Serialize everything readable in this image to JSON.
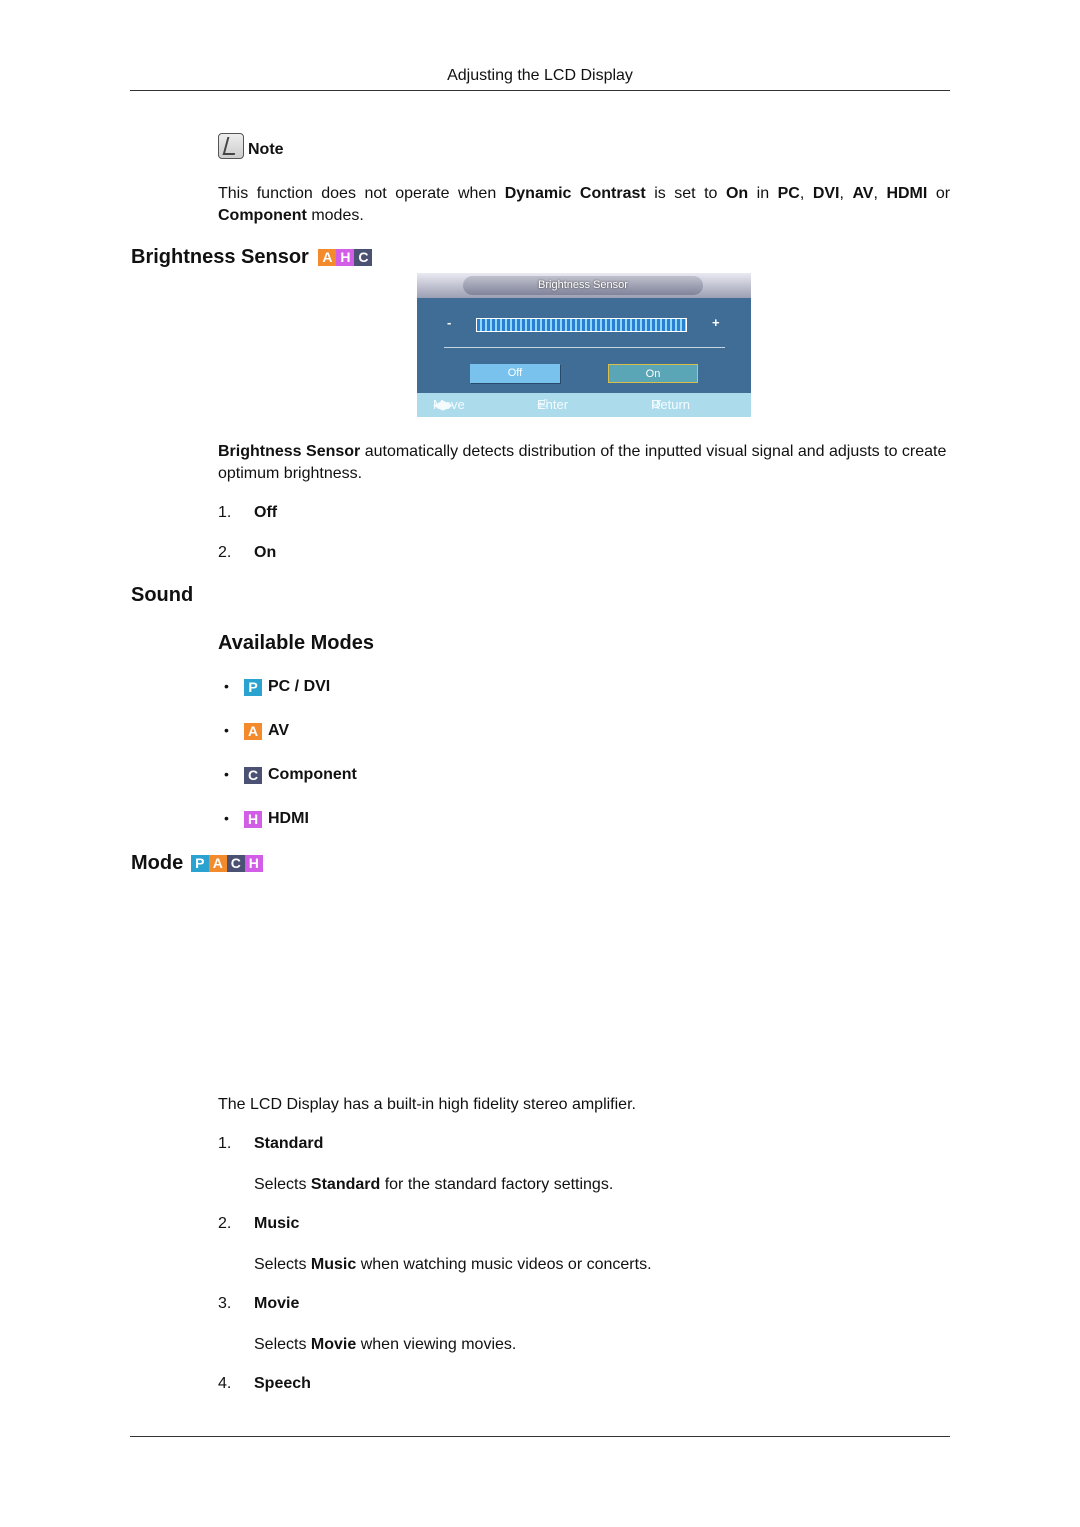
{
  "header": {
    "title": "Adjusting the LCD Display"
  },
  "note": {
    "label": "Note",
    "icon": "note-pencil-icon",
    "text_parts": [
      {
        "t": "This function does not operate when ",
        "b": false
      },
      {
        "t": "Dynamic Contrast",
        "b": true
      },
      {
        "t": " is set to ",
        "b": false
      },
      {
        "t": "On",
        "b": true
      },
      {
        "t": " in ",
        "b": false
      },
      {
        "t": "PC",
        "b": true
      },
      {
        "t": ", ",
        "b": false
      },
      {
        "t": "DVI",
        "b": true
      },
      {
        "t": ", ",
        "b": false
      },
      {
        "t": "AV",
        "b": true
      },
      {
        "t": ", ",
        "b": false
      },
      {
        "t": "HDMI",
        "b": true
      },
      {
        "t": " or ",
        "b": false
      },
      {
        "t": "Component",
        "b": true
      },
      {
        "t": " modes.",
        "b": false
      }
    ]
  },
  "brightness_sensor": {
    "heading": "Brightness Sensor",
    "badges": [
      "A",
      "H",
      "C"
    ],
    "osd": {
      "title": "Brightness Sensor",
      "minus": "-",
      "plus": "+",
      "options": [
        "Off",
        "On"
      ],
      "selected": "On",
      "footer": {
        "move": "Move",
        "enter": "Enter",
        "return": "Return"
      }
    },
    "desc_bold": "Brightness Sensor",
    "desc_rest": " automatically detects distribution of the inputted visual signal and adjusts to create optimum brightness.",
    "items": [
      {
        "num": "1.",
        "label": "Off"
      },
      {
        "num": "2.",
        "label": "On"
      }
    ]
  },
  "sound": {
    "heading": "Sound",
    "available_modes": {
      "heading": "Available Modes",
      "modes": [
        {
          "badge": "P",
          "label": "PC / DVI"
        },
        {
          "badge": "A",
          "label": "AV"
        },
        {
          "badge": "C",
          "label": "Component"
        },
        {
          "badge": "H",
          "label": "HDMI"
        }
      ]
    }
  },
  "mode": {
    "heading": "Mode",
    "badges": [
      "P",
      "A",
      "C",
      "H"
    ],
    "intro": "The LCD Display has a built-in high fidelity stereo amplifier.",
    "items": [
      {
        "num": "1.",
        "label": "Standard",
        "desc_pre": "Selects ",
        "desc_bold": "Standard",
        "desc_post": " for the standard factory settings."
      },
      {
        "num": "2.",
        "label": "Music",
        "desc_pre": "Selects ",
        "desc_bold": "Music",
        "desc_post": " when watching music videos or concerts."
      },
      {
        "num": "3.",
        "label": "Movie",
        "desc_pre": "Selects ",
        "desc_bold": "Movie",
        "desc_post": " when viewing movies."
      },
      {
        "num": "4.",
        "label": "Speech"
      }
    ]
  }
}
